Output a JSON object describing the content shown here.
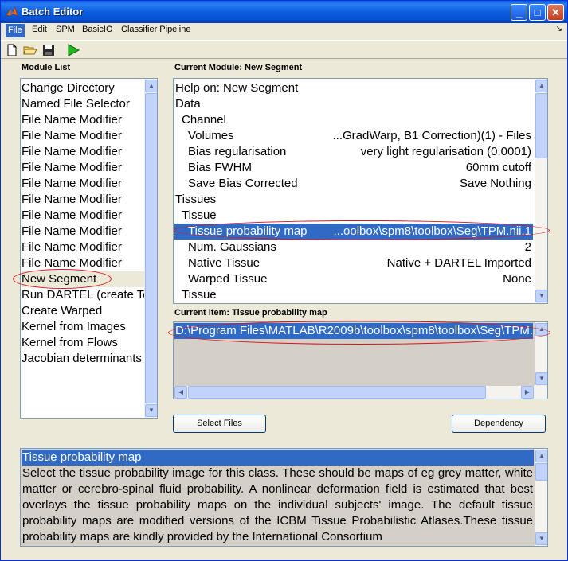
{
  "window": {
    "title": "Batch Editor"
  },
  "title_buttons": {
    "minimize": "_",
    "maximize": "□",
    "close": "✕"
  },
  "menu": [
    {
      "label": "File"
    },
    {
      "label": "Edit"
    },
    {
      "label": "SPM"
    },
    {
      "label": "BasicIO"
    },
    {
      "label": "Classifier Pipeline"
    }
  ],
  "menu_overflow": "↘",
  "module_list": {
    "label": "Module List",
    "items": [
      "Change Directory",
      "Named File Selector",
      "File Name Modifier",
      "File Name Modifier",
      "File Name Modifier",
      "File Name Modifier",
      "File Name Modifier",
      "File Name Modifier",
      "File Name Modifier",
      "File Name Modifier",
      "File Name Modifier",
      "File Name Modifier",
      "New Segment",
      "Run DARTEL (create Te",
      "Create Warped",
      "Kernel from Images",
      "Kernel from Flows",
      "Jacobian determinants"
    ]
  },
  "current_module": {
    "label": "Current Module: New Segment",
    "rows": [
      {
        "name": "Help on: New Segment",
        "value": ""
      },
      {
        "name": "Data",
        "value": ""
      },
      {
        "name": "Channel",
        "value": ""
      },
      {
        "name": "Volumes",
        "value": "...GradWarp, B1 Correction)(1) - Files"
      },
      {
        "name": "Bias regularisation",
        "value": "very light regularisation (0.0001)"
      },
      {
        "name": "Bias FWHM",
        "value": "60mm cutoff"
      },
      {
        "name": "Save Bias Corrected",
        "value": "Save Nothing"
      },
      {
        "name": "Tissues",
        "value": ""
      },
      {
        "name": "Tissue",
        "value": ""
      },
      {
        "name": "Tissue probability map",
        "value": "...oolbox\\spm8\\toolbox\\Seg\\TPM.nii,1"
      },
      {
        "name": "Num. Gaussians",
        "value": "2"
      },
      {
        "name": "Native Tissue",
        "value": "Native + DARTEL Imported"
      },
      {
        "name": "Warped Tissue",
        "value": "None"
      },
      {
        "name": "Tissue",
        "value": ""
      }
    ]
  },
  "current_item": {
    "label": "Current Item: Tissue probability map",
    "value": "D:\\Program Files\\MATLAB\\R2009b\\toolbox\\spm8\\toolbox\\Seg\\TPM.nii,1"
  },
  "buttons": {
    "select_files": "Select Files",
    "dependency": "Dependency"
  },
  "help": {
    "title": "Tissue probability map",
    "text": "Select the tissue probability image for this class. These should be maps of eg grey matter, white matter or cerebro-spinal fluid probability. A nonlinear deformation field is estimated that best overlays the tissue probability maps on the individual subjects' image. The default tissue probability maps are modified versions of the ICBM Tissue Probabilistic Atlases.These tissue probability maps are kindly provided by the International Consortium"
  },
  "scroll_arrows": {
    "up": "▲",
    "down": "▼",
    "left": "◀",
    "right": "▶"
  },
  "colors": {
    "selection": "#316ac5",
    "titlebar": "#0a5fe6",
    "highlight_ellipse": "#e0101a"
  }
}
